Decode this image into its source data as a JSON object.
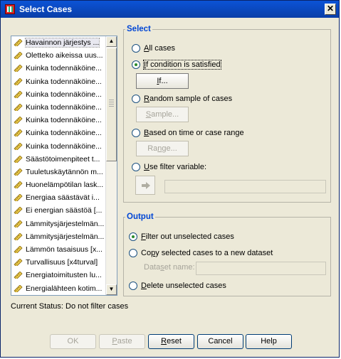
{
  "window": {
    "title": "Select Cases"
  },
  "variables": [
    "Havainnon järjestys ...",
    "Oletteko aikeissa uus...",
    "Kuinka todennäköine...",
    "Kuinka todennäköine...",
    "Kuinka todennäköine...",
    "Kuinka todennäköine...",
    "Kuinka todennäköine...",
    "Kuinka todennäköine...",
    "Kuinka todennäköine...",
    "Säästötoimenpiteet t...",
    "Tuuletuskäytännön m...",
    "Huonelämpötilan lask...",
    "Energiaa säästävät i...",
    "Ei energian säästöä [...",
    "Lämmitysjärjestelmän...",
    "Lämmitysjärjestelmän...",
    "Lämmön tasaisuus [x...",
    "Turvallisuus [x4turval]",
    "Energiatoimitusten lu...",
    "Energialähteen kotim..."
  ],
  "select": {
    "legend": "Select",
    "all_cases": {
      "mn": "A",
      "rest": "ll cases"
    },
    "if_condition": {
      "mn": "I",
      "rest": "f condition is satisfied"
    },
    "if_button": {
      "mn": "I",
      "rest": "f..."
    },
    "random_sample": {
      "mn": "R",
      "rest": "andom sample of cases"
    },
    "sample_button": {
      "mn": "S",
      "rest": "ample..."
    },
    "time_range": {
      "mn": "B",
      "rest": "ased on time or case range"
    },
    "range_button": {
      "pre": "Ra",
      "mn": "n",
      "rest": "ge..."
    },
    "filter_var": {
      "mn": "U",
      "rest": "se filter variable:"
    }
  },
  "output": {
    "legend": "Output",
    "filter_out": {
      "mn": "F",
      "rest": "ilter out unselected cases"
    },
    "copy_new": {
      "pre": "Co",
      "mn": "p",
      "rest": "y selected cases to a new dataset"
    },
    "dataset_name": {
      "pre": "Data",
      "mn": "s",
      "rest": "et name:"
    },
    "delete": {
      "mn": "D",
      "rest": "elete unselected cases"
    }
  },
  "status": "Current Status: Do not filter cases",
  "buttons": {
    "ok": "OK",
    "paste": {
      "mn": "P",
      "rest": "aste"
    },
    "reset": {
      "mn": "R",
      "rest": "eset"
    },
    "cancel": "Cancel",
    "help": "Help"
  }
}
